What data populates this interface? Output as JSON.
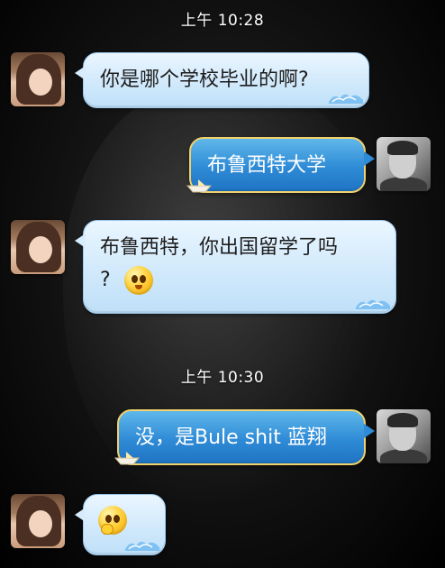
{
  "chat": {
    "timestamps": [
      "上午 10:28",
      "上午 10:30"
    ],
    "messages": [
      {
        "sender": "contact",
        "text": "你是哪个学校毕业的啊?"
      },
      {
        "sender": "me",
        "text": "布鲁西特大学"
      },
      {
        "sender": "contact",
        "text_line1": "布鲁西特，你出国留学了吗",
        "text_line2": "?"
      },
      {
        "sender": "me",
        "text": "没，是Bule shit 蓝翔"
      },
      {
        "sender": "contact",
        "text": ""
      }
    ]
  },
  "icons": {
    "emoji_shy": "shy-smiley-icon",
    "emoji_thinking": "thinking-smiley-icon"
  },
  "colors": {
    "incoming_bubble": "#cfe8fb",
    "outgoing_bubble": "#2f8bd6",
    "outgoing_border": "#f0d16c",
    "timestamp_text": "#ffffff"
  }
}
